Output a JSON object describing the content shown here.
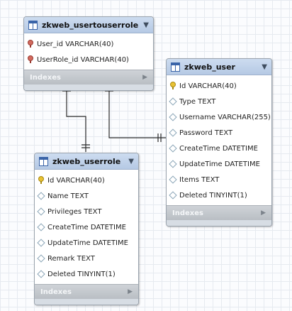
{
  "tables": [
    {
      "id": "usertouserrole",
      "title": "zkweb_usertouserrole",
      "columns": [
        {
          "icon": "foreign-key-icon",
          "text": "User_id VARCHAR(40)"
        },
        {
          "icon": "foreign-key-icon",
          "text": "UserRole_id VARCHAR(40)"
        }
      ],
      "indexes_label": "Indexes"
    },
    {
      "id": "user",
      "title": "zkweb_user",
      "columns": [
        {
          "icon": "primary-key-icon",
          "text": "Id VARCHAR(40)"
        },
        {
          "icon": "column-diamond-icon",
          "text": "Type TEXT"
        },
        {
          "icon": "column-diamond-icon",
          "text": "Username VARCHAR(255)"
        },
        {
          "icon": "column-diamond-icon",
          "text": "Password TEXT"
        },
        {
          "icon": "column-diamond-icon",
          "text": "CreateTime DATETIME"
        },
        {
          "icon": "column-diamond-icon",
          "text": "UpdateTime DATETIME"
        },
        {
          "icon": "column-diamond-icon",
          "text": "Items TEXT"
        },
        {
          "icon": "column-diamond-icon",
          "text": "Deleted TINYINT(1)"
        }
      ],
      "indexes_label": "Indexes"
    },
    {
      "id": "userrole",
      "title": "zkweb_userrole",
      "columns": [
        {
          "icon": "primary-key-icon",
          "text": "Id VARCHAR(40)"
        },
        {
          "icon": "column-diamond-icon",
          "text": "Name TEXT"
        },
        {
          "icon": "column-diamond-icon",
          "text": "Privileges TEXT"
        },
        {
          "icon": "column-diamond-icon",
          "text": "CreateTime DATETIME"
        },
        {
          "icon": "column-diamond-icon",
          "text": "UpdateTime DATETIME"
        },
        {
          "icon": "column-diamond-icon",
          "text": "Remark TEXT"
        },
        {
          "icon": "column-diamond-icon",
          "text": "Deleted TINYINT(1)"
        }
      ],
      "indexes_label": "Indexes"
    }
  ],
  "relationships": [
    {
      "from": "usertouserrole",
      "to": "userrole",
      "from_end": "many",
      "to_end": "one"
    },
    {
      "from": "usertouserrole",
      "to": "user",
      "from_end": "many",
      "to_end": "one"
    }
  ],
  "colors": {
    "connector": "#2b2b2b",
    "header": "#c3d4ec",
    "indexes_bar": "#c4c8cd"
  }
}
